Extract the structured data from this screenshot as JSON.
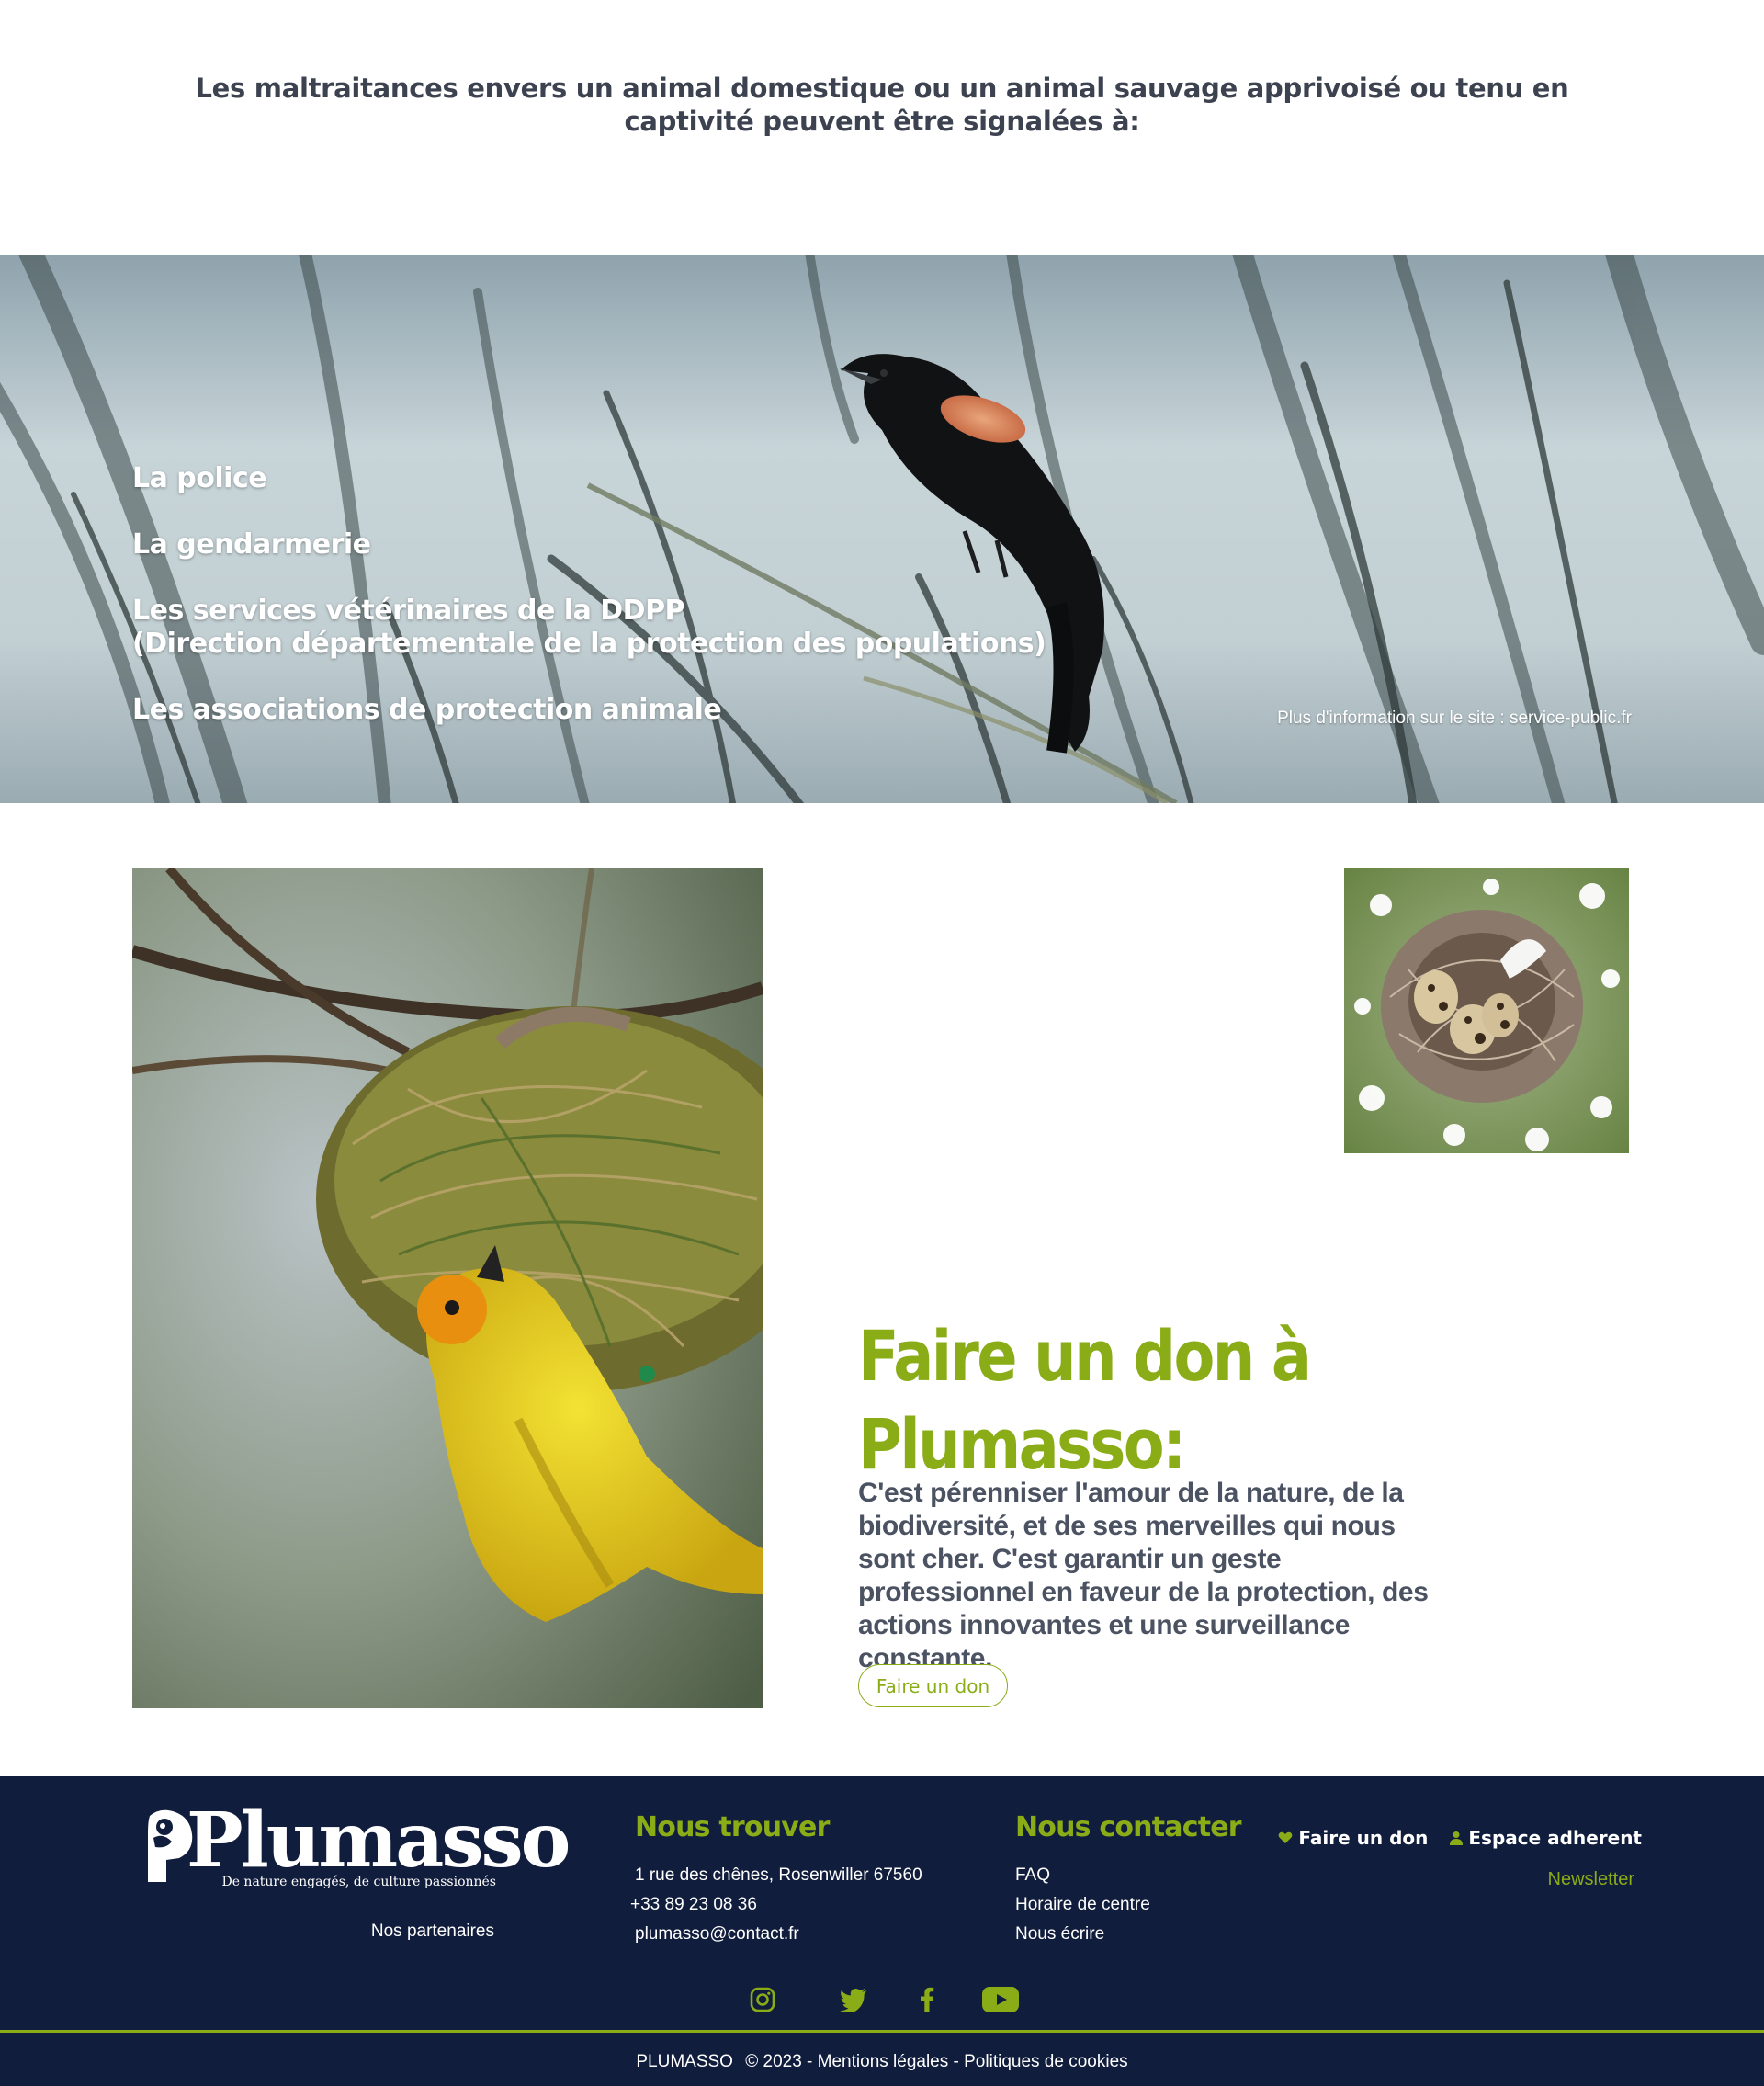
{
  "intro": {
    "text": "Les maltraitances envers un animal domestique ou un animal sauvage apprivoisé ou tenu en captivité peuvent être signalées à:"
  },
  "banner": {
    "items": [
      {
        "line1": "La police",
        "line2": ""
      },
      {
        "line1": "La gendarmerie",
        "line2": ""
      },
      {
        "line1": "Les services vétérinaires de la DDPP",
        "line2": "(Direction départementale de la protection des populations)"
      },
      {
        "line1": "Les associations de protection animale",
        "line2": ""
      }
    ],
    "more_info": "Plus d'information sur le site : service-public.fr"
  },
  "donation": {
    "title": "Faire un don à Plumasso:",
    "text": "C'est pérenniser l'amour de la nature, de la biodiversité, et de ses merveilles qui nous sont cher. C'est garantir un geste professionnel en faveur de la protection, des actions innovantes et une surveillance  constante.",
    "button_label": "Faire un don"
  },
  "footer": {
    "logo_text": "Plumasso",
    "tagline": "De nature engagés, de culture passionnés",
    "partners": "Nos partenaires",
    "find_us": {
      "title": "Nous trouver",
      "lines": [
        "1 rue des chênes, Rosenwiller 67560",
        "+33 89 23 08 36",
        "plumasso@contact.fr"
      ]
    },
    "contact": {
      "title": "Nous contacter",
      "lines": [
        "FAQ",
        "Horaire de centre",
        "Nous écrire"
      ]
    },
    "donate_link": "Faire un don",
    "member_link": "Espace adherent",
    "newsletter": "Newsletter",
    "socials": [
      "instagram-icon",
      "twitter-icon",
      "facebook-icon",
      "youtube-icon"
    ],
    "legal": {
      "brand": "PLUMASSO",
      "copyright": "© 2023 - Mentions légales - Politiques de cookies"
    }
  },
  "colors": {
    "accent": "#8aac17",
    "footer_bg": "#111d3c",
    "text_dark": "#3d4250"
  }
}
